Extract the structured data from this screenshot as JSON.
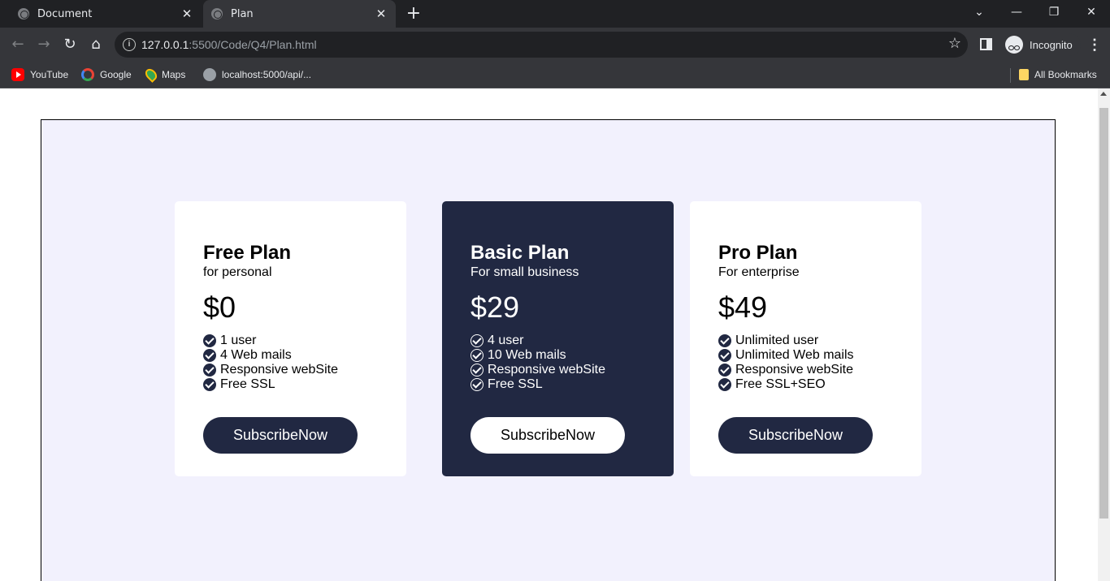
{
  "browser": {
    "tabs": [
      {
        "title": "Document"
      },
      {
        "title": "Plan"
      }
    ],
    "url_host": "127.0.0.1",
    "url_path": ":5500/Code/Q4/Plan.html",
    "profile_label": "Incognito",
    "bookmarks": [
      {
        "label": "YouTube",
        "icon": "youtube-icon"
      },
      {
        "label": "Google",
        "icon": "google-icon"
      },
      {
        "label": "Maps",
        "icon": "maps-icon"
      },
      {
        "label": "localhost:5000/api/...",
        "icon": "globe-icon"
      }
    ],
    "all_bookmarks_label": "All Bookmarks"
  },
  "plans": [
    {
      "title": "Free Plan",
      "subtitle": "for personal",
      "price": "$0",
      "features": [
        "1 user",
        "4 Web mails",
        "Responsive webSite",
        "Free SSL"
      ],
      "button_label": "SubscribeNow"
    },
    {
      "title": "Basic Plan",
      "subtitle": "For small business",
      "price": "$29",
      "features": [
        "4 user",
        "10 Web mails",
        "Responsive webSite",
        "Free SSL"
      ],
      "button_label": "SubscribeNow"
    },
    {
      "title": "Pro Plan",
      "subtitle": "For enterprise",
      "price": "$49",
      "features": [
        "Unlimited user",
        "Unlimited Web mails",
        "Responsive webSite",
        "Free SSL+SEO"
      ],
      "button_label": "SubscribeNow"
    }
  ],
  "colors": {
    "accent": "#212842",
    "page_background": "#f2f1fd",
    "card_background": "#ffffff"
  }
}
